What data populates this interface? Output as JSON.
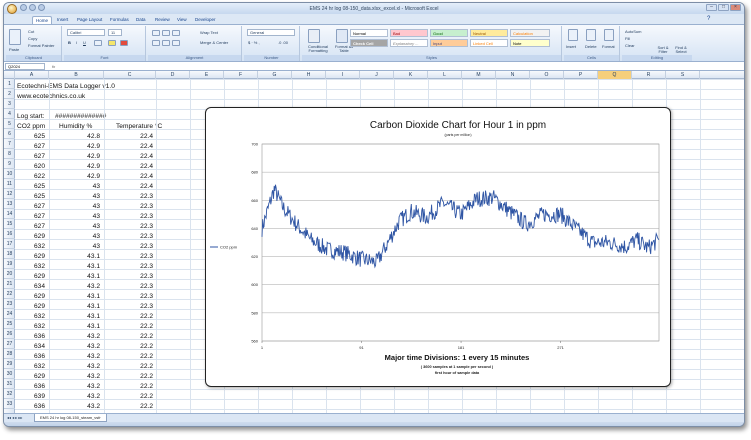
{
  "window": {
    "title": "EMS 24 hr log 08-150_data.xlsx_excel.xl - Microsoft Excel"
  },
  "ribbon": {
    "tabs": [
      "Home",
      "Insert",
      "Page Layout",
      "Formulas",
      "Data",
      "Review",
      "View",
      "Developer"
    ],
    "clipboard": {
      "paste": "Paste",
      "cut": "Cut",
      "copy": "Copy",
      "format_painter": "Format Painter",
      "label": "Clipboard"
    },
    "font": {
      "name": "Calibri",
      "size": "11",
      "label": "Font"
    },
    "alignment": {
      "wrap": "Wrap Text",
      "merge": "Merge & Center",
      "label": "Alignment"
    },
    "number": {
      "format": "General",
      "label": "Number"
    },
    "styles": {
      "conditional": "Conditional Formatting",
      "format_table": "Format as Table",
      "cells": [
        "Normal",
        "Bad",
        "Good",
        "Neutral",
        "Calculation",
        "Check Cell",
        "Explanatory ...",
        "Input",
        "Linked Cell",
        "Note"
      ],
      "label": "Styles"
    },
    "cells": {
      "insert": "Insert",
      "delete": "Delete",
      "format": "Format",
      "label": "Cells"
    },
    "editing": {
      "autosum": "AutoSum",
      "fill": "Fill",
      "clear": "Clear",
      "sort": "Sort & Filter",
      "find": "Find & Select",
      "label": "Editing"
    }
  },
  "formula_bar": {
    "name_box": "Q2024",
    "fx": "fx"
  },
  "columns": [
    "A",
    "B",
    "C",
    "D",
    "E",
    "F",
    "G",
    "H",
    "I",
    "J",
    "K",
    "L",
    "M",
    "N",
    "O",
    "P",
    "Q",
    "R",
    "S"
  ],
  "selected_column": "Q",
  "rows": [
    "1",
    "2",
    "3",
    "4",
    "5",
    "6",
    "7",
    "8",
    "9",
    "10",
    "11",
    "12",
    "13",
    "14",
    "15",
    "16",
    "17",
    "18",
    "19",
    "20",
    "21",
    "22",
    "23",
    "24",
    "25",
    "26",
    "27",
    "28",
    "29",
    "30",
    "31",
    "32",
    "33"
  ],
  "sheet": {
    "title": "Ecotechni-EMS Data Logger   v1.0",
    "website": "www.ecotechnics.co.uk",
    "log_start_label": "Log start:",
    "log_start_value": "##############",
    "headers": [
      "CO2 ppm",
      "Humidity %",
      "Temperature °C"
    ],
    "data": [
      [
        "625",
        "42.8",
        "22.4"
      ],
      [
        "627",
        "42.9",
        "22.4"
      ],
      [
        "627",
        "42.9",
        "22.4"
      ],
      [
        "620",
        "42.9",
        "22.4"
      ],
      [
        "622",
        "42.9",
        "22.4"
      ],
      [
        "625",
        "43",
        "22.4"
      ],
      [
        "625",
        "43",
        "22.3"
      ],
      [
        "627",
        "43",
        "22.3"
      ],
      [
        "627",
        "43",
        "22.3"
      ],
      [
        "627",
        "43",
        "22.3"
      ],
      [
        "629",
        "43",
        "22.3"
      ],
      [
        "632",
        "43",
        "22.3"
      ],
      [
        "629",
        "43.1",
        "22.3"
      ],
      [
        "632",
        "43.1",
        "22.3"
      ],
      [
        "629",
        "43.1",
        "22.3"
      ],
      [
        "634",
        "43.2",
        "22.3"
      ],
      [
        "629",
        "43.1",
        "22.3"
      ],
      [
        "629",
        "43.1",
        "22.3"
      ],
      [
        "632",
        "43.1",
        "22.2"
      ],
      [
        "632",
        "43.1",
        "22.2"
      ],
      [
        "636",
        "43.2",
        "22.2"
      ],
      [
        "634",
        "43.2",
        "22.2"
      ],
      [
        "636",
        "43.2",
        "22.2"
      ],
      [
        "632",
        "43.2",
        "22.2"
      ],
      [
        "629",
        "43.2",
        "22.2"
      ],
      [
        "636",
        "43.2",
        "22.2"
      ],
      [
        "639",
        "43.2",
        "22.2"
      ],
      [
        "636",
        "43.2",
        "22.2"
      ]
    ]
  },
  "sheet_tab": "EMS 24 hr log 08-150_steam_vsfr",
  "chart_data": {
    "type": "line",
    "title": "Carbon Dioxide Chart for Hour 1 in ppm",
    "subtitle": "(parts per million)",
    "xlabel": "Major time Divisions: 1 every 15 minutes",
    "footnote_1": "( 3600 samples at 1 sample per second )",
    "footnote_2": "first hour of sample data",
    "ylim": [
      560,
      700
    ],
    "yticks": [
      "560",
      "580",
      "600",
      "620",
      "640",
      "660",
      "680",
      "700"
    ],
    "xlim": [
      1,
      360
    ],
    "xticks": [
      "1",
      "91",
      "181",
      "271"
    ],
    "grid": true,
    "legend_position": "left",
    "series": [
      {
        "name": "CO2 ppm",
        "color": "#2f55a4",
        "x": [
          1,
          12,
          20,
          32,
          45,
          60,
          75,
          91,
          105,
          115,
          125,
          136,
          150,
          165,
          181,
          195,
          210,
          225,
          240,
          255,
          271,
          285,
          300,
          315,
          330,
          340,
          350,
          360
        ],
        "y": [
          640,
          668,
          655,
          643,
          632,
          625,
          623,
          618,
          616,
          630,
          645,
          652,
          648,
          658,
          650,
          661,
          662,
          652,
          643,
          650,
          650,
          640,
          630,
          630,
          627,
          632,
          626,
          632
        ]
      }
    ]
  }
}
